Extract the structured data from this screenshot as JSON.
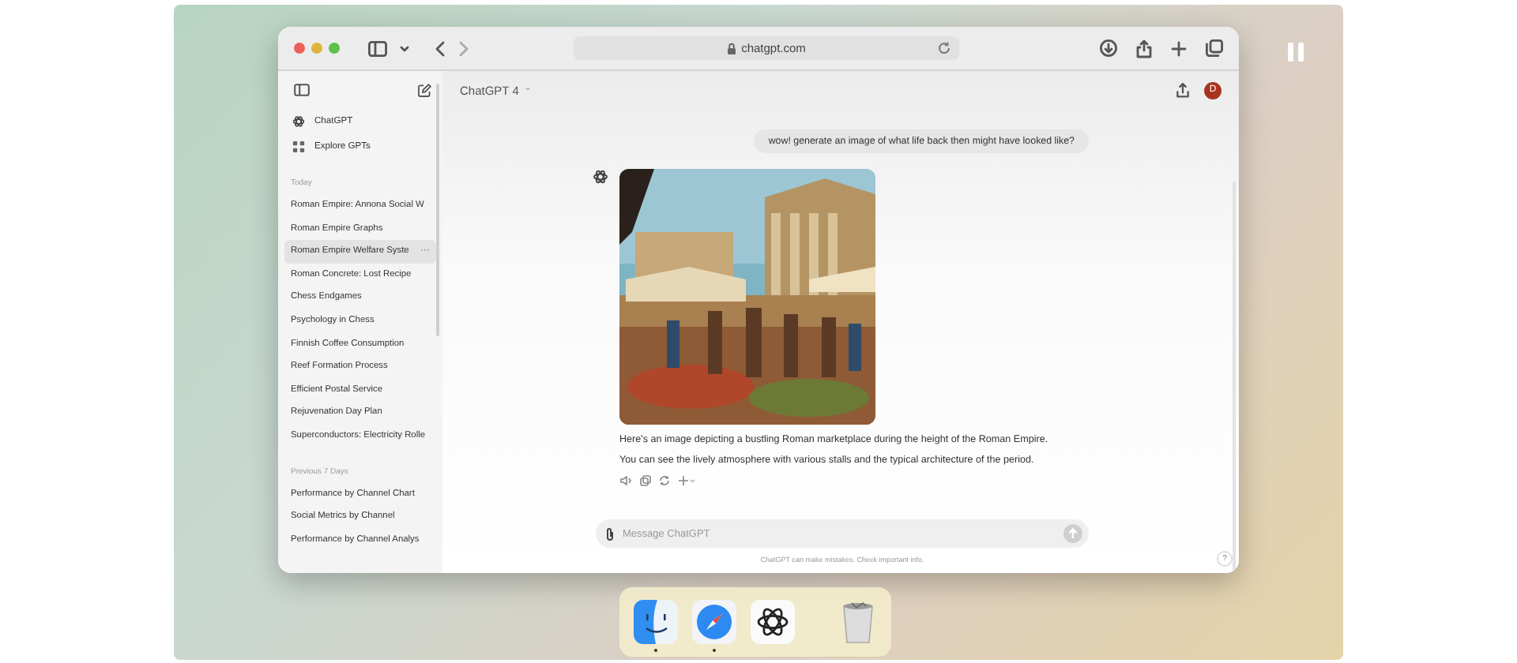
{
  "browser": {
    "url": "chatgpt.com"
  },
  "sidebar": {
    "nav": [
      {
        "kind": "chatgpt",
        "label": "ChatGPT"
      },
      {
        "kind": "explore",
        "label": "Explore GPTs"
      }
    ],
    "sections": [
      {
        "heading": "Today",
        "items": [
          {
            "label": "Roman Empire: Annona Social W",
            "selected": false
          },
          {
            "label": "Roman Empire Graphs",
            "selected": false
          },
          {
            "label": "Roman Empire Welfare Syste",
            "selected": true,
            "options": "···"
          },
          {
            "label": "Roman Concrete: Lost Recipe",
            "selected": false
          },
          {
            "label": "Chess Endgames",
            "selected": false
          },
          {
            "label": "Psychology in Chess",
            "selected": false
          },
          {
            "label": "Finnish Coffee Consumption",
            "selected": false
          },
          {
            "label": "Reef Formation Process",
            "selected": false
          },
          {
            "label": "Efficient Postal Service",
            "selected": false
          },
          {
            "label": "Rejuvenation Day Plan",
            "selected": false
          },
          {
            "label": "Superconductors: Electricity Rolle",
            "selected": false
          }
        ]
      },
      {
        "heading": "Previous 7 Days",
        "items": [
          {
            "label": "Performance by Channel Chart",
            "selected": false
          },
          {
            "label": "Social Metrics by Channel",
            "selected": false
          },
          {
            "label": "Performance by Channel Analys",
            "selected": false
          }
        ]
      }
    ]
  },
  "header": {
    "model": "ChatGPT 4",
    "caret": "⌄",
    "avatar": "D"
  },
  "messages": [
    {
      "kind": "user",
      "text": "wow! generate an image of what life back then might have looked like?"
    },
    {
      "kind": "assistant",
      "image": {
        "kind": "picture"
      },
      "lines": [
        "Here's an image depicting a bustling Roman marketplace during the height of the Roman Empire.",
        "You can see the lively atmosphere with various stalls and the typical architecture of the period."
      ]
    }
  ],
  "composer": {
    "placeholder": "Message ChatGPT"
  },
  "disclaimer": "ChatGPT can make mistakes. Check important info.",
  "help": "?",
  "dock": [
    {
      "kind": "finder",
      "running": true
    },
    {
      "kind": "safari",
      "running": true
    },
    {
      "kind": "chatgpt",
      "running": false
    },
    {
      "kind": "separator"
    },
    {
      "kind": "trash",
      "running": false
    }
  ]
}
